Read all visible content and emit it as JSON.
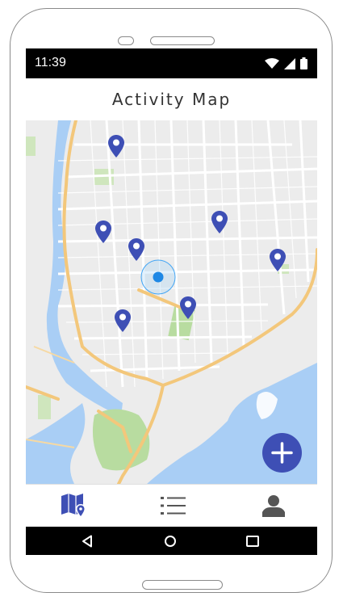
{
  "status_bar": {
    "time": "11:39",
    "icons": [
      "wifi-icon",
      "signal-icon",
      "battery-icon"
    ]
  },
  "app_bar": {
    "title": "Activity Map"
  },
  "map": {
    "pin_color": "#3e4fb5",
    "location_color": "#1e88e5",
    "water_color": "#a9cef5",
    "park_color": "#b8dca0",
    "road_color": "#f3c77b"
  },
  "fab": {
    "icon": "plus-icon",
    "color": "#3e4fb5"
  },
  "bottom_nav": {
    "items": [
      {
        "icon": "map-icon",
        "active": true
      },
      {
        "icon": "list-icon",
        "active": false
      },
      {
        "icon": "profile-icon",
        "active": false
      }
    ]
  },
  "system_nav": {
    "icons": [
      "back-icon",
      "home-icon",
      "recents-icon"
    ]
  }
}
